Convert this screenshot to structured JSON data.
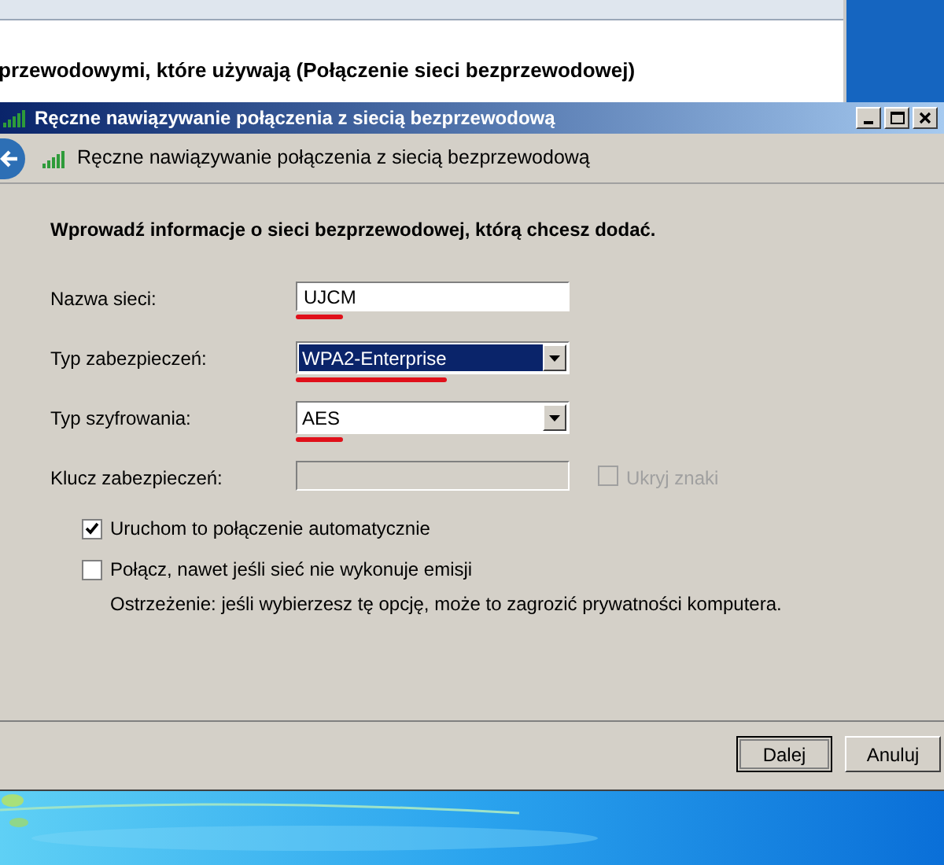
{
  "background_window": {
    "heading": "przewodowymi, które używają (Połączenie sieci bezprzewodowej)"
  },
  "dialog": {
    "title": "Ręczne nawiązywanie połączenia z siecią bezprzewodową",
    "header": "Ręczne nawiązywanie połączenia z siecią bezprzewodową",
    "instruction": "Wprowadź informacje o sieci bezprzewodowej, którą chcesz dodać.",
    "fields": [
      {
        "kind": "text",
        "label": "Nazwa sieci:",
        "value": "UJCM",
        "disabled": false,
        "highlighted": false,
        "underlined": true
      },
      {
        "kind": "dropdown",
        "label": "Typ zabezpieczeń:",
        "value": "WPA2-Enterprise",
        "disabled": false,
        "highlighted": true,
        "underlined": true
      },
      {
        "kind": "dropdown",
        "label": "Typ szyfrowania:",
        "value": "AES",
        "disabled": false,
        "highlighted": false,
        "underlined": true
      },
      {
        "kind": "text",
        "label": "Klucz zabezpieczeń:",
        "disabled": true,
        "highlighted": false,
        "underlined": false,
        "option": {
          "label": "Ukryj znaki",
          "checked": false,
          "disabled": true
        }
      }
    ],
    "options": [
      {
        "label": "Uruchom to połączenie automatycznie",
        "checked": true
      },
      {
        "label": "Połącz, nawet jeśli sieć nie wykonuje emisji",
        "checked": false,
        "note": "Ostrzeżenie: jeśli wybierzesz tę opcję, może to zagrozić prywatności komputera."
      }
    ],
    "buttons": [
      {
        "label": "Dalej",
        "default": true
      },
      {
        "label": "Anuluj",
        "default": false
      }
    ]
  }
}
